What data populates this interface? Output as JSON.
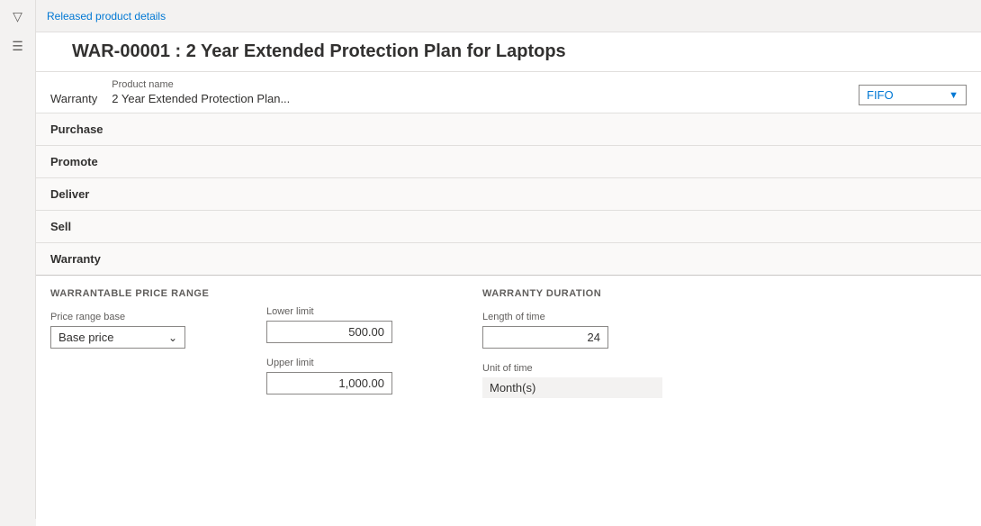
{
  "breadcrumb": {
    "label": "Released product details"
  },
  "page": {
    "title": "WAR-00001 : 2 Year Extended Protection Plan for Laptops"
  },
  "product_header": {
    "type_label": "",
    "type_value": "Warranty",
    "product_name_label": "Product name",
    "product_name_value": "2 Year Extended Protection Plan...",
    "fifo_label": "FIFO",
    "dropdown_arrow": "▼"
  },
  "sections": [
    {
      "id": "purchase",
      "label": "Purchase"
    },
    {
      "id": "promote",
      "label": "Promote"
    },
    {
      "id": "deliver",
      "label": "Deliver"
    },
    {
      "id": "sell",
      "label": "Sell"
    }
  ],
  "warranty_section": {
    "header": "Warranty",
    "warrantable_group_label": "WARRANTABLE PRICE RANGE",
    "price_range_base_label": "Price range base",
    "price_range_base_value": "Base price",
    "dropdown_arrow": "⌄",
    "lower_limit_label": "Lower limit",
    "lower_limit_value": "500.00",
    "upper_limit_label": "Upper limit",
    "upper_limit_value": "1,000.00",
    "warranty_duration_group_label": "WARRANTY DURATION",
    "length_of_time_label": "Length of time",
    "length_of_time_value": "24",
    "unit_of_time_label": "Unit of time",
    "unit_of_time_value": "Month(s)"
  },
  "icons": {
    "filter": "⊿",
    "hamburger": "☰"
  }
}
